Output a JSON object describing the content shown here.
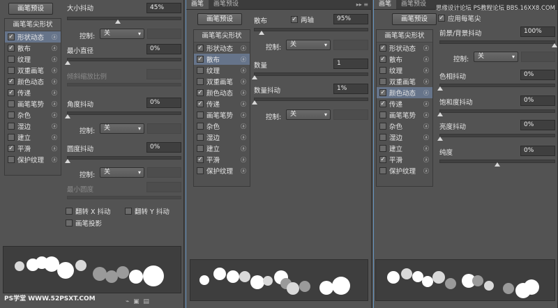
{
  "panel1": {
    "button": "画笔预设",
    "list_header": "画笔笔尖形状",
    "items": [
      {
        "label": "形状动态",
        "checked": true,
        "selected": true
      },
      {
        "label": "散布",
        "checked": true
      },
      {
        "label": "纹理",
        "checked": false
      },
      {
        "label": "双重画笔",
        "checked": false
      },
      {
        "label": "颜色动态",
        "checked": true
      },
      {
        "label": "传递",
        "checked": true
      },
      {
        "label": "画笔笔势",
        "checked": false
      },
      {
        "label": "杂色",
        "checked": false
      },
      {
        "label": "湿边",
        "checked": false
      },
      {
        "label": "建立",
        "checked": false
      },
      {
        "label": "平滑",
        "checked": true
      },
      {
        "label": "保护纹理",
        "checked": false
      }
    ],
    "size_jitter_label": "大小抖动",
    "size_jitter_value": "45%",
    "control_label": "控制:",
    "control_value": "关",
    "min_diameter_label": "最小直径",
    "min_diameter_value": "0%",
    "tilt_scale_label": "倾斜缩放比例",
    "angle_jitter_label": "角度抖动",
    "angle_jitter_value": "0%",
    "control2_label": "控制:",
    "control2_value": "关",
    "roundness_jitter_label": "圆度抖动",
    "roundness_jitter_value": "0%",
    "control3_label": "控制:",
    "control3_value": "关",
    "min_roundness_label": "最小圆度",
    "flip_x_label": "翻转 X 抖动",
    "flip_y_label": "翻转 Y 抖动",
    "brush_projection_label": "画笔投影",
    "watermark": "PS学堂 WWW.52PSXT.COM"
  },
  "panel2": {
    "tabs": [
      "画笔",
      "画笔预设"
    ],
    "button": "画笔预设",
    "list_header": "画笔笔尖形状",
    "items": [
      {
        "label": "形状动态",
        "checked": true
      },
      {
        "label": "散布",
        "checked": true,
        "selected": true
      },
      {
        "label": "纹理",
        "checked": false
      },
      {
        "label": "双重画笔",
        "checked": false
      },
      {
        "label": "颜色动态",
        "checked": true
      },
      {
        "label": "传递",
        "checked": true
      },
      {
        "label": "画笔笔势",
        "checked": false
      },
      {
        "label": "杂色",
        "checked": false
      },
      {
        "label": "湿边",
        "checked": false
      },
      {
        "label": "建立",
        "checked": false
      },
      {
        "label": "平滑",
        "checked": true
      },
      {
        "label": "保护纹理",
        "checked": false
      }
    ],
    "scatter_label": "散布",
    "both_axes_label": "两轴",
    "scatter_value": "95%",
    "control_label": "控制:",
    "control_value": "关",
    "count_label": "数量",
    "count_value": "1",
    "count_jitter_label": "数量抖动",
    "count_jitter_value": "1%",
    "control2_label": "控制:",
    "control2_value": "关"
  },
  "panel3": {
    "tabs": [
      "画笔",
      "画笔预设"
    ],
    "button": "画笔预设",
    "list_header": "画笔笔尖形状",
    "items": [
      {
        "label": "形状动态",
        "checked": true
      },
      {
        "label": "散布",
        "checked": true
      },
      {
        "label": "纹理",
        "checked": false
      },
      {
        "label": "双重画笔",
        "checked": false
      },
      {
        "label": "颜色动态",
        "checked": true,
        "selected": true
      },
      {
        "label": "传递",
        "checked": true
      },
      {
        "label": "画笔笔势",
        "checked": false
      },
      {
        "label": "杂色",
        "checked": false
      },
      {
        "label": "湿边",
        "checked": false
      },
      {
        "label": "建立",
        "checked": false
      },
      {
        "label": "平滑",
        "checked": true
      },
      {
        "label": "保护纹理",
        "checked": false
      }
    ],
    "apply_per_tip_label": "应用每笔尖",
    "fg_bg_jitter_label": "前景/背景抖动",
    "fg_bg_jitter_value": "100%",
    "control_label": "控制:",
    "control_value": "关",
    "hue_jitter_label": "色相抖动",
    "hue_jitter_value": "0%",
    "saturation_jitter_label": "饱和度抖动",
    "saturation_jitter_value": "0%",
    "brightness_jitter_label": "亮度抖动",
    "brightness_jitter_value": "0%",
    "purity_label": "纯度",
    "purity_value": "0%",
    "watermark": "思缘设计论坛 PS教程论坛 BBS.16XX8.COM"
  },
  "icons": {
    "check": "check-icon",
    "lock": "lock-icon",
    "dropdown": "chevron-down-icon"
  }
}
